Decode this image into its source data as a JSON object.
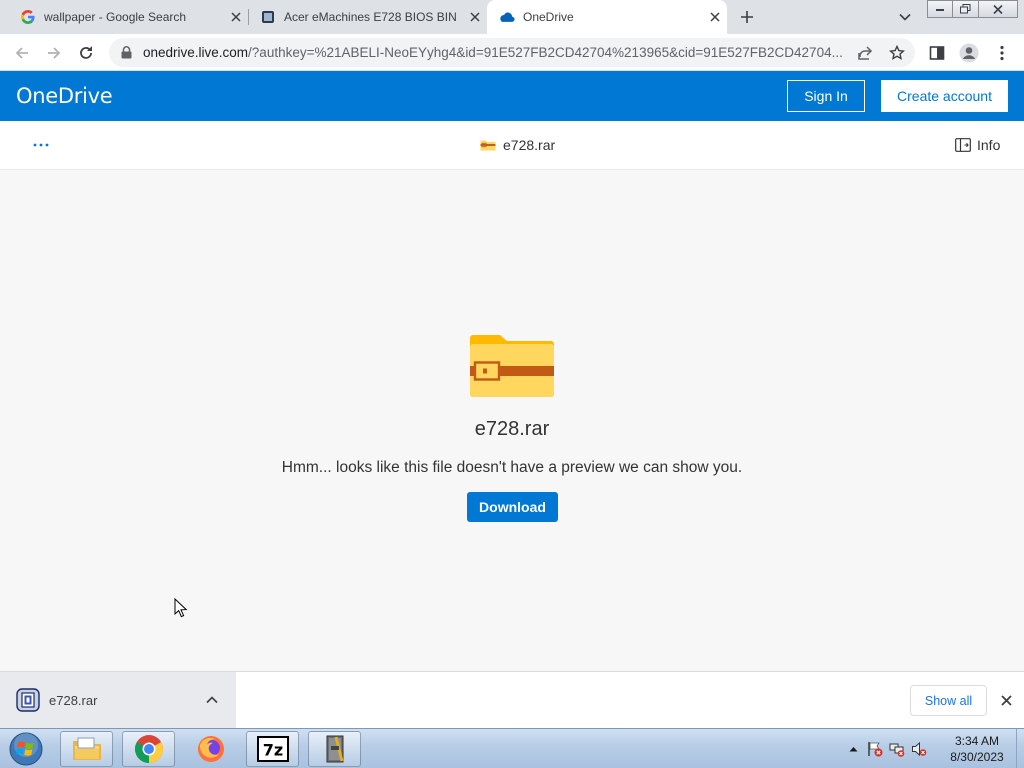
{
  "browser": {
    "tabs": [
      {
        "title": "wallpaper - Google Search",
        "favicon": "google-favicon",
        "active": false
      },
      {
        "title": "Acer eMachines E728 BIOS BIN",
        "favicon": "page-favicon",
        "active": false
      },
      {
        "title": "OneDrive",
        "favicon": "onedrive-cloud-favicon",
        "active": true
      }
    ],
    "address": {
      "host": "onedrive.live.com",
      "path": "/?authkey=%21ABELI-NeoEYyhg4&id=91E527FB2CD42704%213965&cid=91E527FB2CD42704..."
    }
  },
  "header": {
    "brand": "OneDrive",
    "sign_in": "Sign In",
    "create_account": "Create account",
    "color": "#0078d4"
  },
  "commandbar": {
    "more": "···",
    "file_name": "e728.rar",
    "info": "Info"
  },
  "preview": {
    "file_name": "e728.rar",
    "message": "Hmm... looks like this file doesn't have a preview we can show you.",
    "download": "Download"
  },
  "downloads": {
    "item": "e728.rar",
    "show_all": "Show all"
  },
  "taskbar": {
    "apps": [
      "windows-explorer-icon",
      "chrome-icon",
      "firefox-icon",
      "7zip-icon",
      "winrar-icon"
    ],
    "time": "3:34 AM",
    "date": "8/30/2023"
  }
}
